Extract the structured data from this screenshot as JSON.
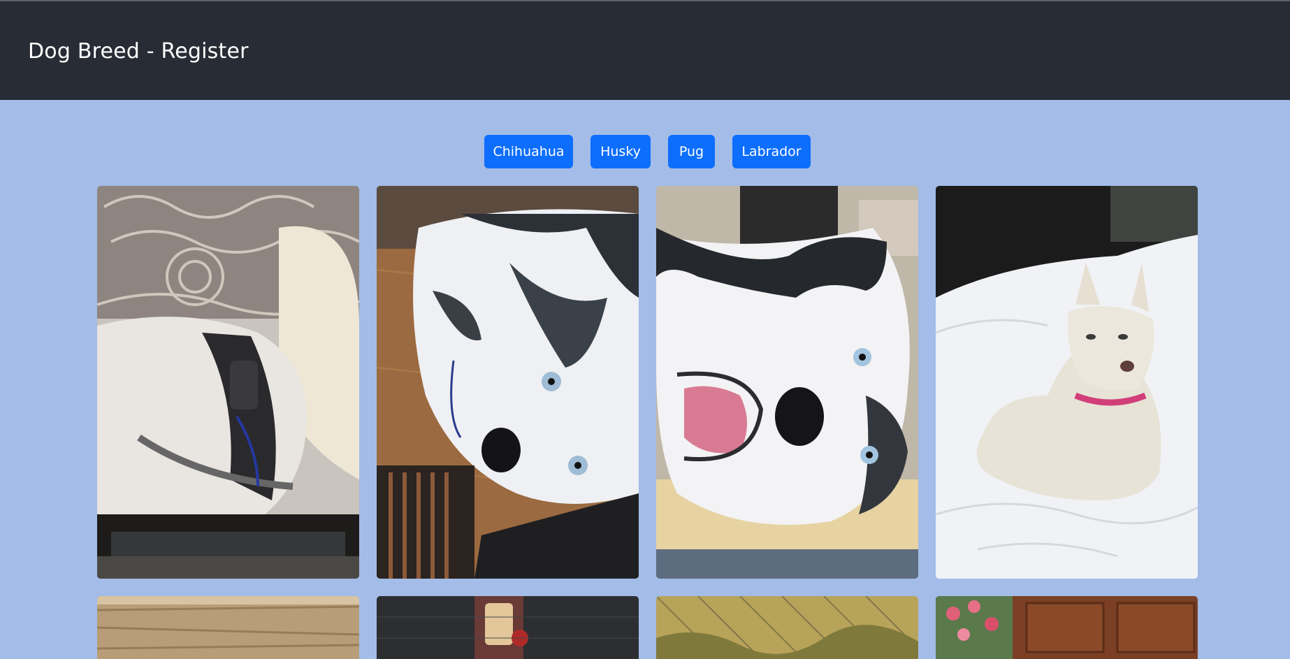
{
  "header": {
    "title": "Dog Breed - Register"
  },
  "breeds": {
    "chihuahua": "Chihuahua",
    "husky": "Husky",
    "pug": "Pug",
    "labrador": "Labrador"
  },
  "gallery": {
    "images": [
      {
        "description": "husky photo 1"
      },
      {
        "description": "husky photo 2"
      },
      {
        "description": "husky photo 3"
      },
      {
        "description": "husky photo 4"
      },
      {
        "description": "husky photo 5"
      },
      {
        "description": "husky photo 6"
      },
      {
        "description": "husky photo 7"
      },
      {
        "description": "husky photo 8"
      }
    ]
  },
  "colors": {
    "page_background": "#a3bce8",
    "header_background": "#282c34",
    "button_primary": "#0d6efd"
  }
}
